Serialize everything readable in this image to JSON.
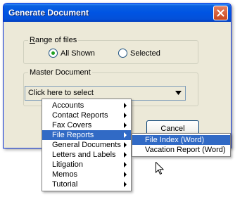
{
  "window": {
    "title": "Generate Document"
  },
  "range_group": {
    "legend_prefix": "",
    "legend_mnemonic": "R",
    "legend_rest": "ange of files",
    "options": [
      {
        "label": "All Shown",
        "selected": true
      },
      {
        "label": "Selected",
        "selected": false
      }
    ]
  },
  "master_group": {
    "legend": "Master Document",
    "combo_value": "Click here to select"
  },
  "buttons": {
    "cancel": "Cancel"
  },
  "menu": {
    "items": [
      {
        "label": "Accounts",
        "has_submenu": true
      },
      {
        "label": "Contact Reports",
        "has_submenu": true
      },
      {
        "label": "Fax Covers",
        "has_submenu": true
      },
      {
        "label": "File Reports",
        "has_submenu": true,
        "selected": true
      },
      {
        "label": "General Documents",
        "has_submenu": true
      },
      {
        "label": "Letters and Labels",
        "has_submenu": true
      },
      {
        "label": "Litigation",
        "has_submenu": true
      },
      {
        "label": "Memos",
        "has_submenu": true
      },
      {
        "label": "Tutorial",
        "has_submenu": true
      }
    ]
  },
  "submenu": {
    "items": [
      {
        "label": "File Index (Word)",
        "selected": true
      },
      {
        "label": "Vacation Report (Word)",
        "selected": false
      }
    ]
  },
  "icons": {
    "close": "close-icon",
    "dropdown": "chevron-down-icon",
    "cursor": "mouse-pointer-icon"
  },
  "colors": {
    "titlebar": "#0054E3",
    "selection": "#316AC5",
    "dialog_bg": "#ECE9D8",
    "close_button": "#C8471E"
  }
}
